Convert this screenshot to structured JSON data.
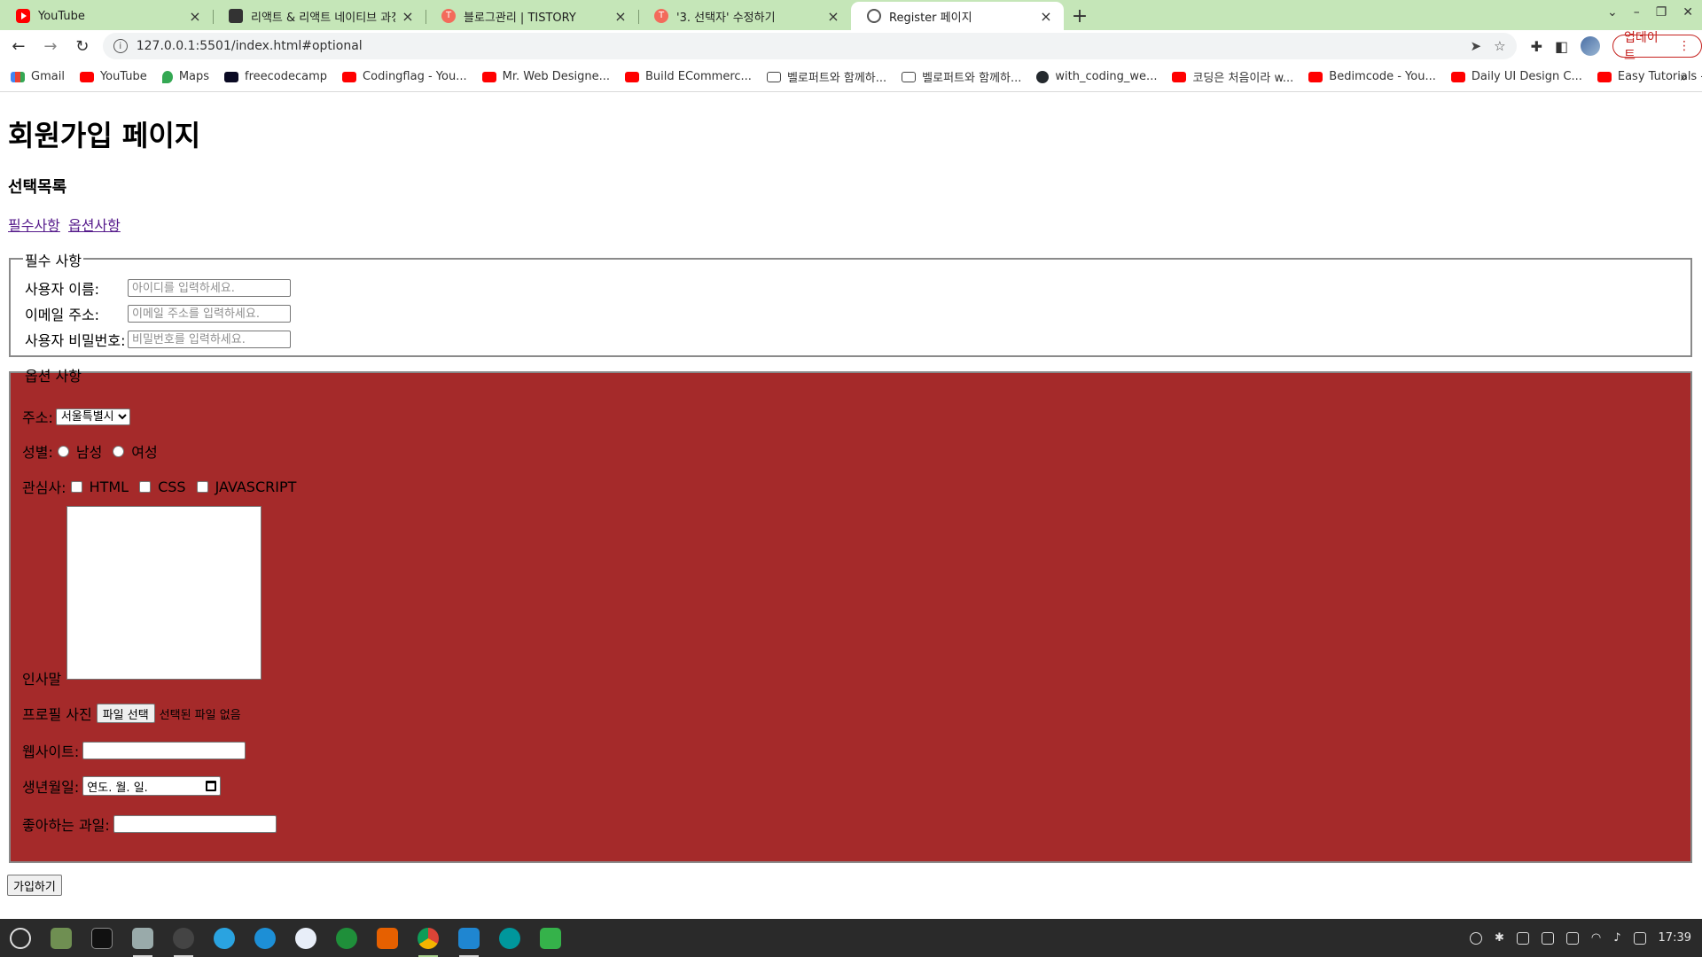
{
  "browser": {
    "tabs": [
      {
        "title": "YouTube",
        "favicon": "youtube-icon"
      },
      {
        "title": "리액트 & 리액트 네이티브 과정 ✎",
        "favicon": "document-icon"
      },
      {
        "title": "블로그관리 | TISTORY",
        "favicon": "tistory-icon"
      },
      {
        "title": "'3. 선택자' 수정하기",
        "favicon": "tistory-icon"
      },
      {
        "title": "Register 페이지",
        "favicon": "globe-icon"
      }
    ],
    "url": "127.0.0.1:5501/index.html#optional",
    "update_label": "업데이트",
    "bookmarks": [
      "Gmail",
      "YouTube",
      "Maps",
      "freecodecamp",
      "Codingflag - You...",
      "Mr. Web Designe...",
      "Build ECommerc...",
      "벨로퍼트와 함께하...",
      "벨로퍼트와 함께하...",
      "with_coding_we...",
      "코딩은 처음이라 w...",
      "Bedimcode - You...",
      "Daily UI Design C...",
      "Easy Tutorials - Y..."
    ]
  },
  "page": {
    "title": "회원가입 페이지",
    "subtitle": "선택목록",
    "links": {
      "required": "필수사항",
      "optional": "옵션사항"
    },
    "required": {
      "legend": "필수 사항",
      "username_label": "사용자 이름:",
      "username_placeholder": "아이디를 입력하세요.",
      "email_label": "이메일 주소:",
      "email_placeholder": "이메일 주소를 입력하세요.",
      "password_label": "사용자 비밀번호:",
      "password_placeholder": "비밀번호를 입력하세요."
    },
    "optional": {
      "legend": "옵션 사항",
      "address_label": "주소:",
      "address_selected": "서울특별시",
      "gender_label": "성별:",
      "gender_male": "남성",
      "gender_female": "여성",
      "interest_label": "관심사:",
      "interest_html": "HTML",
      "interest_css": "CSS",
      "interest_js": "JAVASCRIPT",
      "greeting_label": "인사말",
      "photo_label": "프로필 사진",
      "file_button": "파일 선택",
      "file_status": "선택된 파일 없음",
      "website_label": "웹사이트:",
      "birthday_label": "생년월일:",
      "birthday_placeholder": "연도. 월. 일.",
      "fruit_label": "좋아하는 과일:",
      "background_color": "#a52a2a"
    },
    "submit_label": "가입하기"
  },
  "taskbar": {
    "clock": "17:39"
  }
}
